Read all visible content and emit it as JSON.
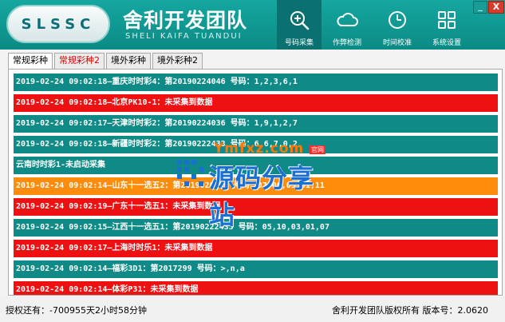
{
  "header": {
    "logo": "SLSSC",
    "title": "舍利开发团队",
    "subtitle": "SHELI KAIFA TUANDUI"
  },
  "nav": [
    {
      "label": "号码采集",
      "icon": "search-plus-icon",
      "active": true
    },
    {
      "label": "作弊检测",
      "icon": "cloud-icon",
      "active": false
    },
    {
      "label": "时间校准",
      "icon": "clock-icon",
      "active": false
    },
    {
      "label": "系统设置",
      "icon": "grid-icon",
      "active": false
    }
  ],
  "window": {
    "minimize": "_",
    "close": "X"
  },
  "tabs": [
    {
      "label": "常规彩种",
      "active": true,
      "alert": false
    },
    {
      "label": "常规彩种2",
      "active": false,
      "alert": true
    },
    {
      "label": "境外彩种",
      "active": false,
      "alert": false
    },
    {
      "label": "境外彩种2",
      "active": false,
      "alert": false
    }
  ],
  "rows": [
    {
      "text": "2019-02-24 09:02:18—重庆时时彩4：第20190224046 号码：1,2,3,6,1",
      "status": "teal"
    },
    {
      "text": "2019-02-24 09:02:18—北京PK10-1：未采集到数据",
      "status": "red"
    },
    {
      "text": "2019-02-24 09:02:17—天津时时彩2：第20190224036 号码：1,9,1,2,7",
      "status": "teal"
    },
    {
      "text": "2019-02-24 09:02:18—新疆时时彩2：第20190222433 号码：6,6,7,0,2",
      "status": "teal"
    },
    {
      "text": "云南时时彩1-未启动采集",
      "status": "teal"
    },
    {
      "text": "2019-02-24 09:02:14—山东十一选五2：第2019020123 号码：07,06,05,01,11",
      "status": "orange"
    },
    {
      "text": "2019-02-24 09:02:19—广东十一选五1：未采集到数据",
      "status": "red"
    },
    {
      "text": "2019-02-24 09:02:15—江西十一选五1：第20190222435 号码：05,10,03,01,07",
      "status": "teal"
    },
    {
      "text": "2019-02-24 09:02:17—上海时时乐1：未采集到数据",
      "status": "red"
    },
    {
      "text": "2019-02-24 09:02:14—福彩3D1：第2017299 号码：>,n,a",
      "status": "teal"
    },
    {
      "text": "2019-02-24 09:02:14—体彩P31：未采集到数据",
      "status": "red"
    }
  ],
  "watermark": {
    "top": "Ymfxz.com",
    "tag": "官网",
    "main": "源码分享站"
  },
  "status": {
    "left": "授权还有：-700955天2小时58分钟",
    "right": "舍利开发团队版权所有 版本号：2.0620"
  }
}
